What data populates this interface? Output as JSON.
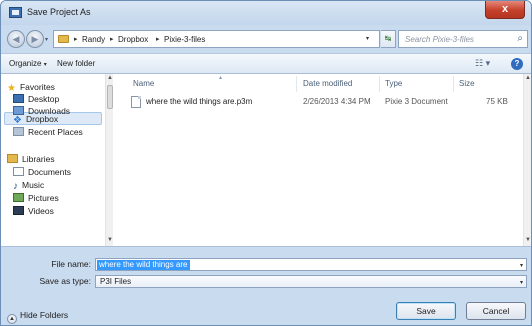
{
  "window": {
    "title": "Save Project As",
    "close_glyph": "x",
    "icons": {
      "app": "app-icon",
      "close": "close-icon"
    }
  },
  "nav": {
    "back_glyph": "◀",
    "forward_glyph": "▶",
    "breadcrumbs": [
      "Randy",
      "Dropbox",
      "Pixie-3-files"
    ],
    "separator": "▸",
    "dropdown_glyph": "▾",
    "refresh_glyph": "↹",
    "search_placeholder": "Search Pixie-3-files",
    "search_glyph": "⌕"
  },
  "toolbar": {
    "organize": "Organize",
    "organize_arrow": "▾",
    "new_folder": "New folder",
    "view_glyph": "☷ ▾",
    "help_glyph": "?"
  },
  "sidebar": {
    "groups": [
      {
        "label": "Favorites",
        "icon": "star-icon",
        "items": [
          {
            "label": "Desktop",
            "icon": "desktop-icon"
          },
          {
            "label": "Downloads",
            "icon": "downloads-icon"
          },
          {
            "label": "Dropbox",
            "icon": "dropbox-icon",
            "selected": true
          },
          {
            "label": "Recent Places",
            "icon": "recent-places-icon"
          }
        ]
      },
      {
        "label": "Libraries",
        "icon": "libraries-icon",
        "items": [
          {
            "label": "Documents",
            "icon": "documents-icon"
          },
          {
            "label": "Music",
            "icon": "music-icon"
          },
          {
            "label": "Pictures",
            "icon": "pictures-icon"
          },
          {
            "label": "Videos",
            "icon": "videos-icon"
          }
        ]
      }
    ],
    "star_glyph": "★",
    "dropbox_glyph": "❖",
    "music_glyph": "♪"
  },
  "file_list": {
    "columns": [
      "Name",
      "Date modified",
      "Type",
      "Size"
    ],
    "sort_glyph": "▴",
    "rows": [
      {
        "name": "where the wild things are.p3m",
        "date_modified": "2/26/2013 4:34 PM",
        "type": "Pixie 3 Document",
        "size": "75 KB",
        "icon": "document-file-icon"
      }
    ]
  },
  "form": {
    "file_name_label": "File name:",
    "file_name_value": "where the wild things are",
    "save_as_type_label": "Save as type:",
    "save_as_type_value": "P3I Files",
    "dropdown_glyph": "▾",
    "hide_folders": "Hide Folders",
    "hide_folders_glyph": "▲",
    "save": "Save",
    "cancel": "Cancel"
  },
  "colors": {
    "chrome": "#c9dbee",
    "selection": "#3399ff",
    "close_button": "#c5402a"
  }
}
